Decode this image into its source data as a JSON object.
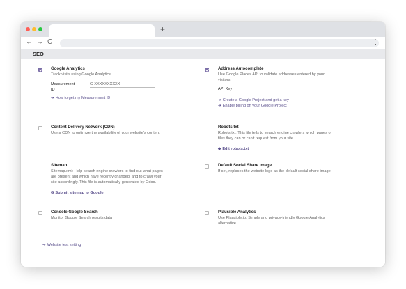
{
  "browser": {
    "new_tab": "+",
    "back": "←",
    "forward": "→",
    "reload": "C",
    "menu": "⋮"
  },
  "section_title": "SEO",
  "left": {
    "analytics": {
      "checked": true,
      "title": "Google Analytics",
      "desc": "Track visits using Google Analytics",
      "label_line1": "Measurement",
      "label_line2": "ID",
      "value": "G-XXXXXXXXXX",
      "link": "How to get my Measurement ID"
    },
    "cdn": {
      "checked": false,
      "title": "Content Delivery Network (CDN)",
      "desc": "Use a CDN to optimize the availability of your website's content"
    },
    "sitemap": {
      "title": "Sitemap",
      "desc_l1": "Sitemap.xml: Help search engine crawlers to find out what pages",
      "desc_l2": "are present and which have recently changed, and to crawl your",
      "desc_l3": "site accordingly. This file is automatically generated by Odoo.",
      "link": "Submit sitemap to Google"
    },
    "console": {
      "checked": false,
      "title": "Console Google Search",
      "desc": "Monitor Google Search results data"
    },
    "test_link": "Website test setting"
  },
  "right": {
    "autocomplete": {
      "checked": true,
      "title": "Address Autocomplete",
      "desc_l1": "Use Google Places API to validate addresses entered by your",
      "desc_l2": "visitors",
      "api_label": "API Key",
      "api_value": "",
      "link1": "Create a Google Project and get a key",
      "link2": "Enable billing on your Google Project"
    },
    "robots": {
      "title": "Robots.txt",
      "desc_l1": "Robots.txt: This file tells to search engine crawlers which pages or",
      "desc_l2": "files they can or can't request from your site.",
      "link": "Edit robots.txt"
    },
    "social": {
      "checked": false,
      "title": "Default Social Share Image",
      "desc": "If set, replaces the website logo as the default social share image."
    },
    "plausible": {
      "checked": false,
      "title": "Plausible Analytics",
      "desc_l1": "Use Plausible.io, Simple and privacy-friendly Google Analytics",
      "desc_l2": "alternative"
    }
  },
  "colors": {
    "accent": "#7c6fa8",
    "link": "#5a4f8c"
  }
}
